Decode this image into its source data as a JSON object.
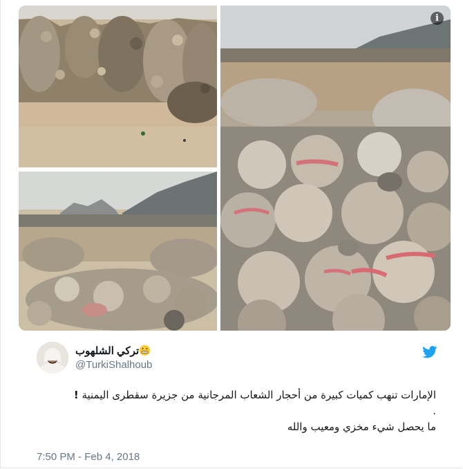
{
  "author": {
    "display_name": "تركي الشلهوب",
    "emoji": "grimacing-zipper-face-emoji",
    "screen_name": "@TurkiShalhoub"
  },
  "tweet": {
    "line_1": "الإمارات تنهب كميات كبيرة من أحجار الشعاب المرجانية من جزيرة سقطرى اليمنية",
    "line_1_mark": "!",
    "line_2": ".",
    "line_3": "ما يحصل شيء مخزي ومعيب والله"
  },
  "timestamp": "7:50 PM - Feb 4, 2018",
  "icons": {
    "info": "info-icon",
    "twitter": "twitter-bird-icon"
  },
  "colors": {
    "twitter_blue": "#1da1f2",
    "secondary_text": "#657786",
    "primary_text": "#14171a",
    "border": "#e1e8ed"
  }
}
